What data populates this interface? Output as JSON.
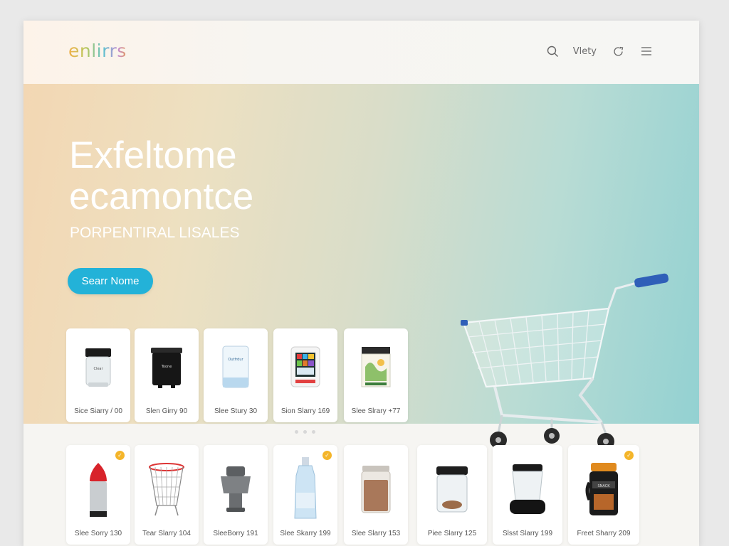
{
  "header": {
    "logo": "enlirrs",
    "nav_text": "Vlety"
  },
  "hero": {
    "title_line1": "Exfeltome",
    "title_line2": "ecamontce",
    "subtitle": "PORPENTIRAL LISALES",
    "cta_label": "Searr Nome"
  },
  "featured": [
    {
      "label": "Sice Siarry / 00"
    },
    {
      "label": "Slen Girry 90"
    },
    {
      "label": "Slee Stury 30"
    },
    {
      "label": "Sion Slarry 169"
    },
    {
      "label": "Slee Slrary +77"
    }
  ],
  "products": [
    {
      "label": "Slee Sorry 130",
      "badge": "✓"
    },
    {
      "label": "Tear Slarry 104",
      "badge": ""
    },
    {
      "label": "SleeBorry 191",
      "badge": ""
    },
    {
      "label": "Slee Skarry 199",
      "badge": "✓"
    },
    {
      "label": "Slee Slarry 153",
      "badge": ""
    },
    {
      "label": "Piee Slarry 125",
      "badge": ""
    },
    {
      "label": "Slsst Slarry 199",
      "badge": ""
    },
    {
      "label": "Freet Sharry 209",
      "badge": "✓"
    }
  ],
  "colors": {
    "accent": "#23b2d8",
    "badge": "#f4b52a"
  }
}
